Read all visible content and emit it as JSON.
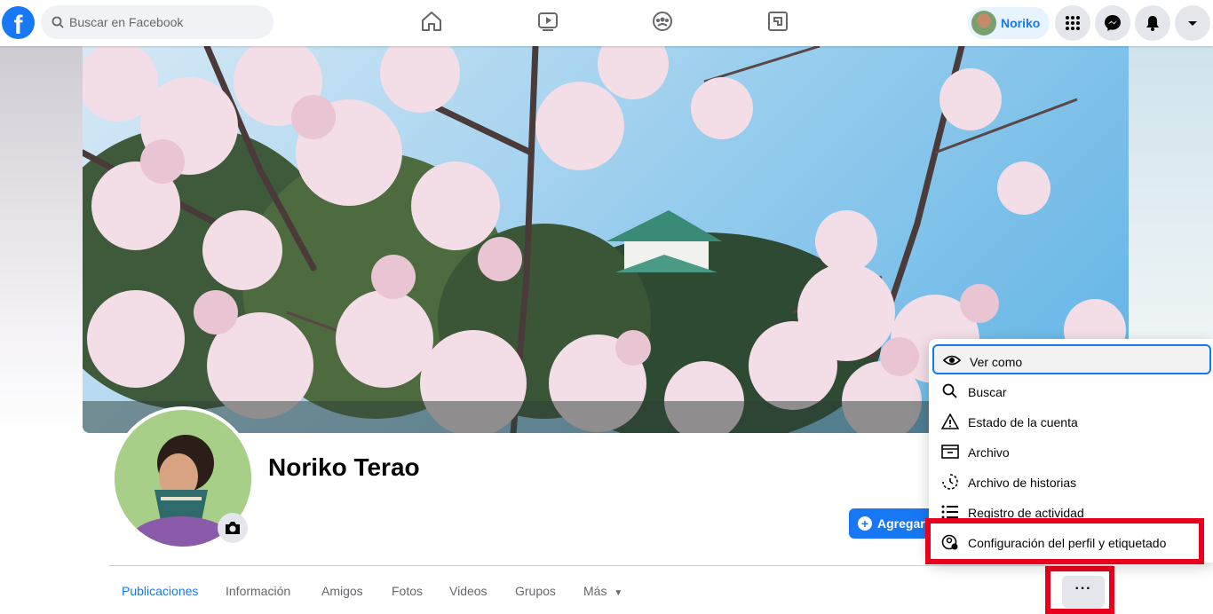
{
  "search": {
    "placeholder": "Buscar en Facebook"
  },
  "header": {
    "user_name": "Noriko"
  },
  "profile": {
    "name": "Noriko Terao",
    "add_button_label": "Agregar"
  },
  "tabs": [
    "Publicaciones",
    "Información",
    "Amigos",
    "Fotos",
    "Videos",
    "Grupos",
    "Más"
  ],
  "more_button_label": "···",
  "menu": {
    "items": [
      {
        "label": "Ver como",
        "icon": "eye-icon"
      },
      {
        "label": "Buscar",
        "icon": "search-icon"
      },
      {
        "label": "Estado de la cuenta",
        "icon": "warning-icon"
      },
      {
        "label": "Archivo",
        "icon": "archive-icon"
      },
      {
        "label": "Archivo de historias",
        "icon": "history-icon"
      },
      {
        "label": "Registro de actividad",
        "icon": "list-icon"
      },
      {
        "label": "Configuración del perfil y etiquetado",
        "icon": "profile-settings-icon"
      }
    ]
  },
  "colors": {
    "accent": "#1877f2",
    "highlight": "#e8001c"
  }
}
